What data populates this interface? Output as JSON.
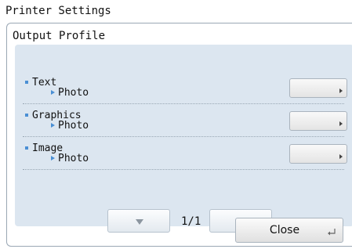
{
  "window": {
    "title": "Printer Settings"
  },
  "panel": {
    "title": "Output Profile"
  },
  "settings": [
    {
      "label": "Text",
      "value": "Photo",
      "button_label": ""
    },
    {
      "label": "Graphics",
      "value": "Photo",
      "button_label": ""
    },
    {
      "label": "Image",
      "value": "Photo",
      "button_label": ""
    }
  ],
  "pager": {
    "indicator": "1/1",
    "prev_icon": "triangle-down-icon",
    "next_icon": "triangle-up-icon"
  },
  "footer": {
    "close_label": "Close",
    "close_icon": "enter-icon"
  },
  "colors": {
    "accent": "#4a8fd4",
    "list_background": "#dce6f0",
    "panel_border": "#9aa7b4"
  }
}
